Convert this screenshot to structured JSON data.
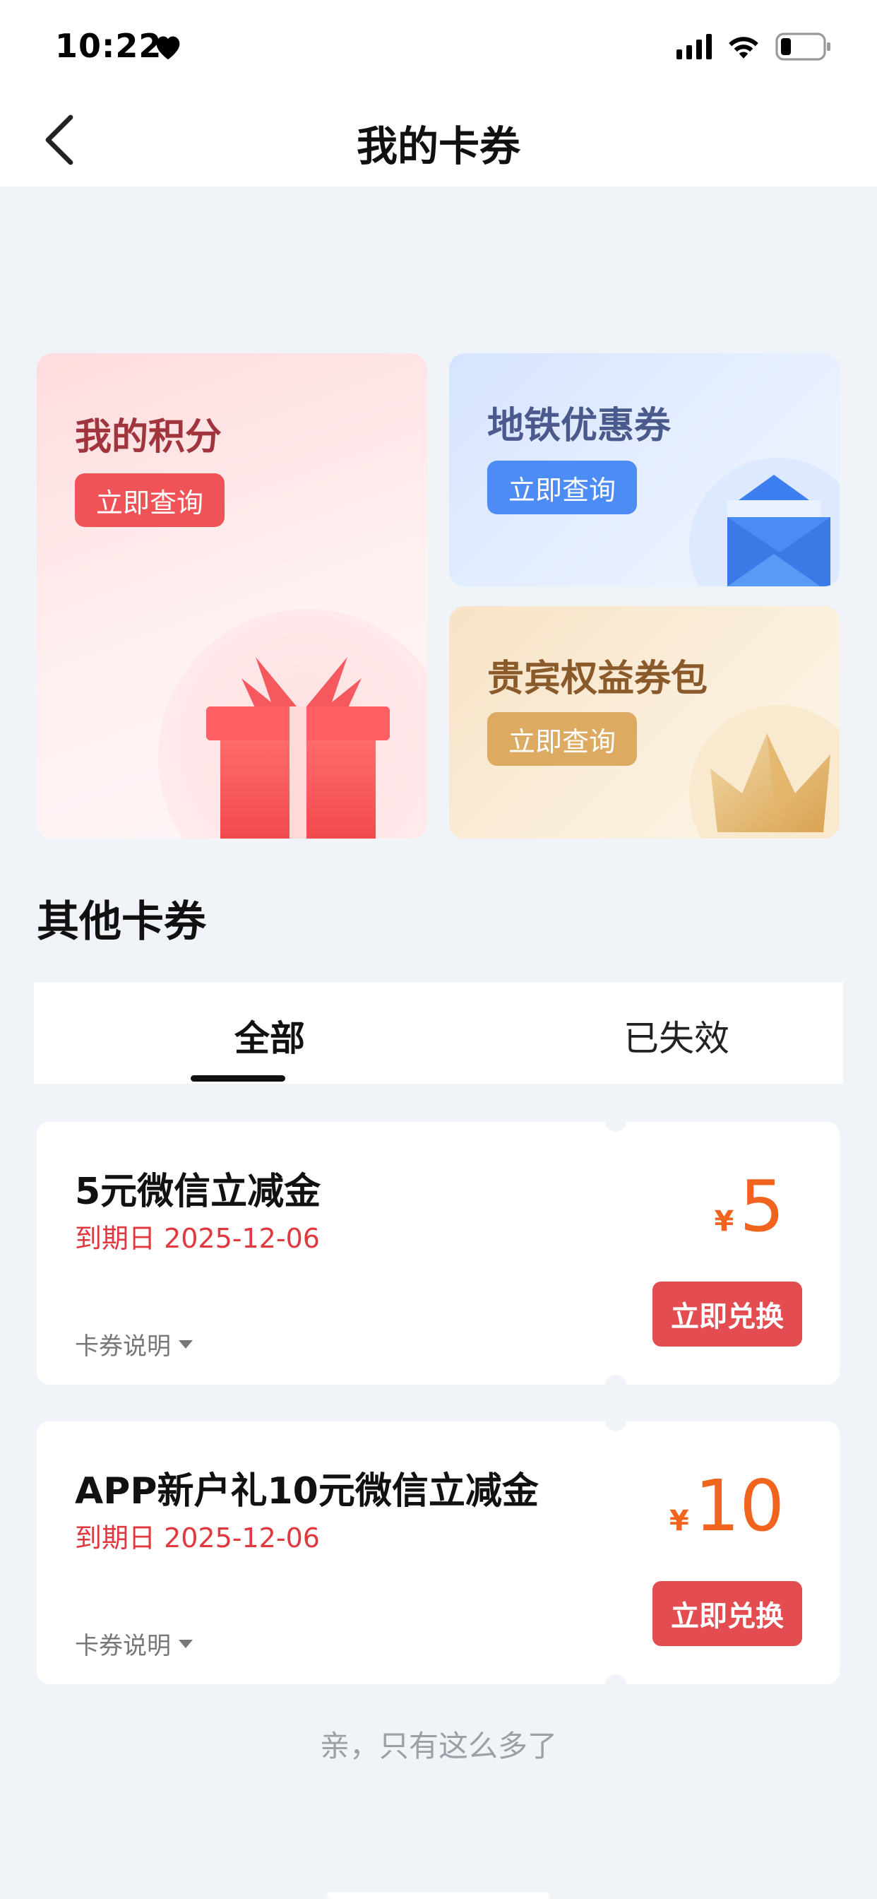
{
  "status_bar": {
    "time": "10:22"
  },
  "nav": {
    "title": "我的卡券"
  },
  "cards": {
    "points": {
      "title": "我的积分",
      "button": "立即查询"
    },
    "subway": {
      "title": "地铁优惠券",
      "button": "立即查询"
    },
    "vip": {
      "title": "贵宾权益券包",
      "button": "立即查询"
    }
  },
  "other_section": {
    "title": "其他卡券",
    "tabs": [
      {
        "label": "全部",
        "active": true
      },
      {
        "label": "已失效",
        "active": false
      }
    ]
  },
  "coupons": [
    {
      "name": "5元微信立减金",
      "expiry": "到期日 2025-12-06",
      "desc_label": "卡券说明",
      "currency": "¥",
      "amount": "5",
      "button": "立即兑换"
    },
    {
      "name": "APP新户礼10元微信立减金",
      "expiry": "到期日 2025-12-06",
      "desc_label": "卡券说明",
      "currency": "¥",
      "amount": "10",
      "button": "立即兑换"
    }
  ],
  "footer": {
    "note": "亲，只有这么多了"
  },
  "colors": {
    "accent_red": "#e34c50",
    "price_orange": "#f0641e",
    "expiry_red": "#e0383e",
    "background": "#f0f3f7"
  },
  "icons": [
    "heart-icon",
    "signal-icon",
    "wifi-icon",
    "battery-icon",
    "back-icon",
    "gift-icon",
    "envelope-icon",
    "crown-icon",
    "caret-down-icon"
  ]
}
